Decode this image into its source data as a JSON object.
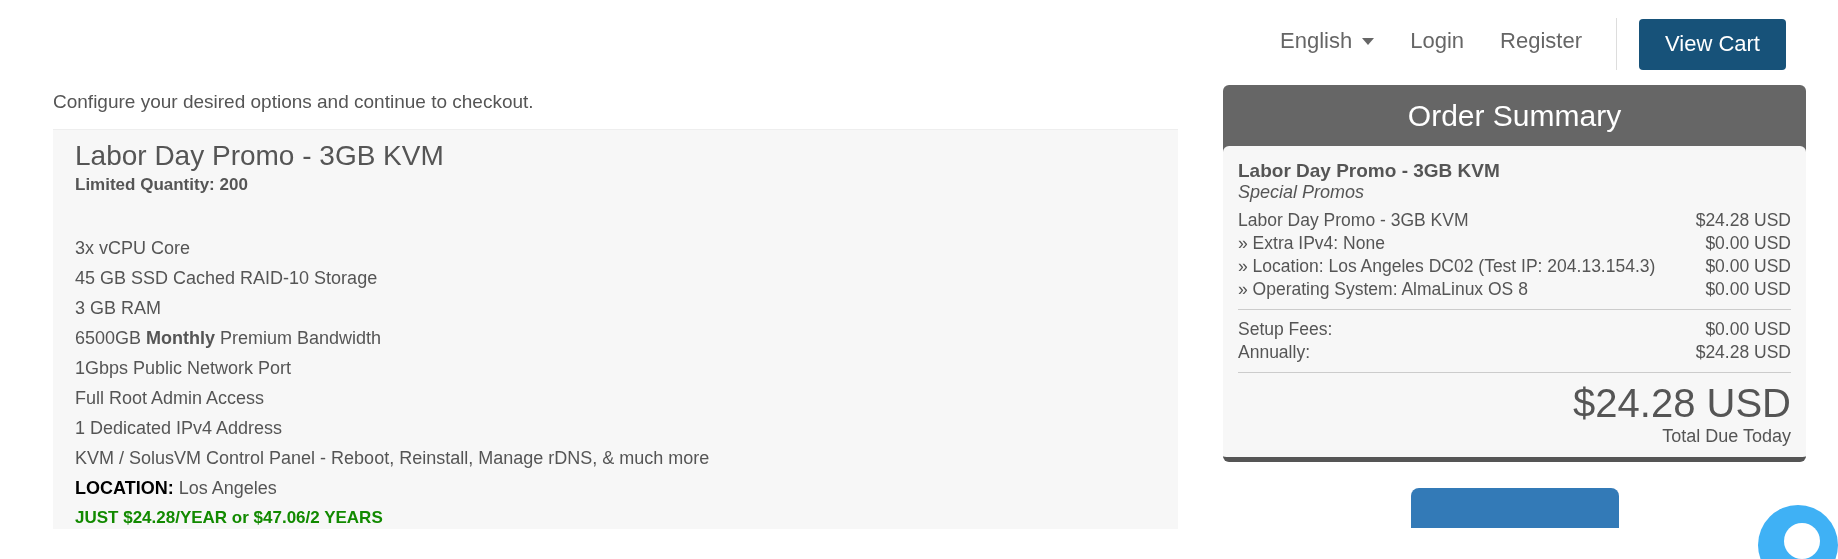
{
  "header": {
    "language": {
      "label": "English"
    },
    "links": [
      "Login",
      "Register"
    ],
    "cart_button": "View Cart"
  },
  "intro": "Configure your desired options and continue to checkout.",
  "product": {
    "title": "Labor Day Promo - 3GB KVM",
    "quantity": "Limited Quantity: 200",
    "features": [
      {
        "kind": "feature",
        "text": "3x vCPU Core"
      },
      {
        "kind": "feature",
        "text": "45 GB SSD Cached RAID-10 Storage"
      },
      {
        "kind": "feature",
        "text": "3 GB RAM"
      },
      {
        "kind": "feature",
        "text": "6500GB **Monthly** Premium Bandwidth"
      },
      {
        "kind": "feature",
        "text": "1Gbps Public Network Port"
      },
      {
        "kind": "feature",
        "text": "Full Root Admin Access"
      },
      {
        "kind": "feature",
        "text": "1 Dedicated IPv4 Address"
      },
      {
        "kind": "feature",
        "text": "KVM / SolusVM Control Panel - Reboot, Reinstall, Manage rDNS, & much more"
      },
      {
        "kind": "location",
        "label": "LOCATION:",
        "text": "Los Angeles"
      },
      {
        "kind": "promo",
        "text": "JUST $24.28/YEAR or $47.06/2 YEARS"
      }
    ]
  },
  "summary": {
    "title": "Order Summary",
    "product": "Labor Day Promo - 3GB KVM",
    "group": "Special Promos",
    "items": [
      {
        "label": "Labor Day Promo - 3GB KVM",
        "price": "$24.28 USD"
      },
      {
        "label": "» Extra IPv4: None",
        "price": "$0.00 USD"
      },
      {
        "label": "» Location: Los Angeles DC02 (Test IP: 204.13.154.3)",
        "price": "$0.00 USD"
      },
      {
        "label": "» Operating System: AlmaLinux OS 8",
        "price": "$0.00 USD"
      }
    ],
    "fees": [
      {
        "label": "Setup Fees:",
        "price": "$0.00 USD"
      },
      {
        "label": "Annually:",
        "price": "$24.28 USD"
      }
    ],
    "total": "$24.28 USD",
    "total_label": "Total Due Today"
  }
}
